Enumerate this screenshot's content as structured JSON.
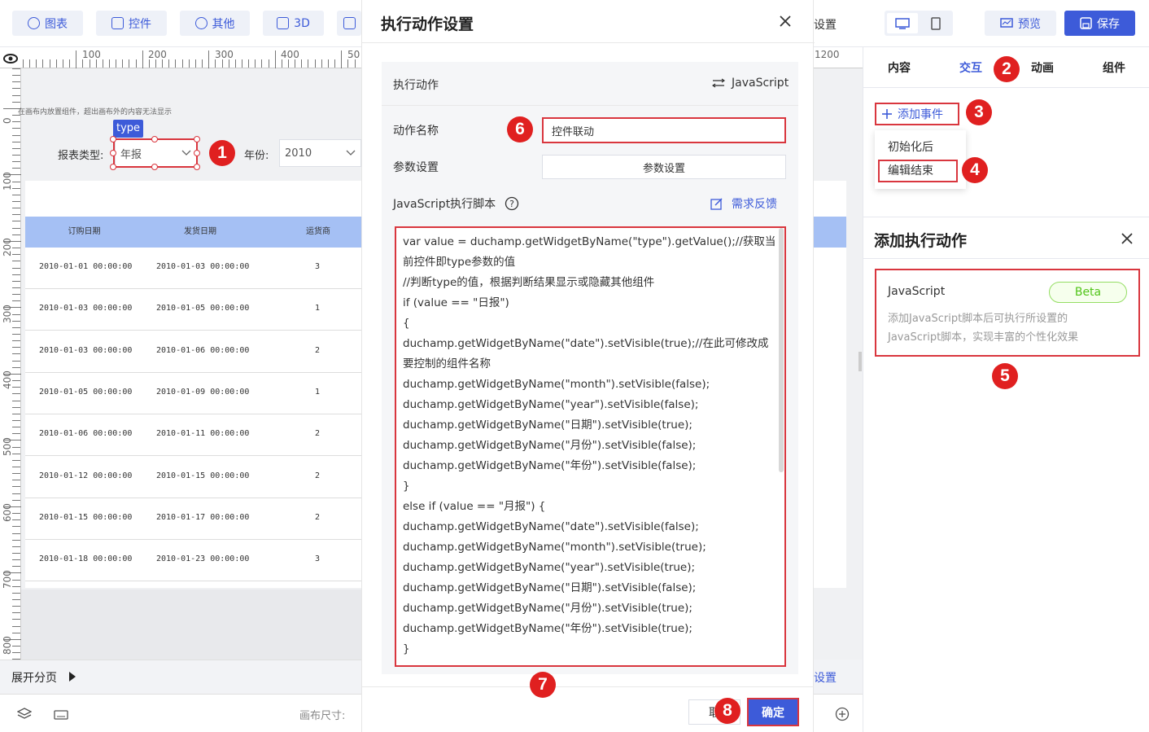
{
  "toolbar": {
    "chart_label": "图表",
    "widget_label": "控件",
    "other_label": "其他",
    "threed_label": "3D",
    "settings_partial": "设置",
    "preview_label": "预览",
    "save_label": "保存"
  },
  "canvas": {
    "hint": "在画布内放置组件，超出画布外的内容无法显示",
    "type_tag": "type",
    "report_type_label": "报表类型:",
    "report_type_value": "年报",
    "year_label": "年份:",
    "year_value": "2010",
    "ruler_top": [
      "100",
      "200",
      "300",
      "400",
      "50"
    ],
    "ruler_left": [
      "0",
      "100",
      "200",
      "300",
      "400",
      "500",
      "600",
      "700",
      "800"
    ],
    "table": {
      "headers": [
        "订购日期",
        "发货日期",
        "运货商"
      ],
      "rows": [
        [
          "2010-01-01 00:00:00",
          "2010-01-03 00:00:00",
          "3"
        ],
        [
          "2010-01-03 00:00:00",
          "2010-01-05 00:00:00",
          "1"
        ],
        [
          "2010-01-03 00:00:00",
          "2010-01-06 00:00:00",
          "2"
        ],
        [
          "2010-01-05 00:00:00",
          "2010-01-09 00:00:00",
          "1"
        ],
        [
          "2010-01-06 00:00:00",
          "2010-01-11 00:00:00",
          "2"
        ],
        [
          "2010-01-12 00:00:00",
          "2010-01-15 00:00:00",
          "2"
        ],
        [
          "2010-01-15 00:00:00",
          "2010-01-17 00:00:00",
          "2"
        ],
        [
          "2010-01-18 00:00:00",
          "2010-01-23 00:00:00",
          "3"
        ]
      ]
    },
    "expand_paging": "展开分页",
    "canvas_size_label": "画布尺寸:"
  },
  "dialog": {
    "title": "执行动作设置",
    "exec_action_label": "执行动作",
    "exec_action_value": "JavaScript",
    "action_name_label": "动作名称",
    "action_name_value": "控件联动",
    "param_label": "参数设置",
    "param_button": "参数设置",
    "script_label": "JavaScript执行脚本",
    "feedback_link": "需求反馈",
    "script_lines": [
      "var value = duchamp.getWidgetByName(\"type\").getValue();//获取当",
      "前控件即type参数的值",
      "//判断type的值，根据判断结果显示或隐藏其他组件",
      "if (value == \"日报\")",
      "{",
      "duchamp.getWidgetByName(\"date\").setVisible(true);//在此可修改成",
      "要控制的组件名称",
      "duchamp.getWidgetByName(\"month\").setVisible(false);",
      "duchamp.getWidgetByName(\"year\").setVisible(false);",
      "duchamp.getWidgetByName(\"日期\").setVisible(true);",
      "duchamp.getWidgetByName(\"月份\").setVisible(false);",
      "duchamp.getWidgetByName(\"年份\").setVisible(false);",
      "}",
      "else if (value == \"月报\") {",
      "duchamp.getWidgetByName(\"date\").setVisible(false);",
      "duchamp.getWidgetByName(\"month\").setVisible(true);",
      "duchamp.getWidgetByName(\"year\").setVisible(true);",
      "duchamp.getWidgetByName(\"日期\").setVisible(false);",
      "duchamp.getWidgetByName(\"月份\").setVisible(true);",
      "duchamp.getWidgetByName(\"年份\").setVisible(true);",
      "}"
    ],
    "cancel_label": "取",
    "confirm_label": "确定"
  },
  "right_panel": {
    "tabs": [
      "内容",
      "交互",
      "动画",
      "组件"
    ],
    "add_event": "添加事件",
    "event_options": [
      "初始化后",
      "编辑结束"
    ],
    "add_action_title": "添加执行动作",
    "js_card_title": "JavaScript",
    "js_card_badge": "Beta",
    "js_card_desc_1": "添加JavaScript脚本后可执行所设置的",
    "js_card_desc_2": "JavaScript脚本，实现丰富的个性化效果",
    "ruler_partial": "1200",
    "settings_partial": "设置"
  },
  "badges": [
    "1",
    "2",
    "3",
    "4",
    "5",
    "6",
    "7",
    "8"
  ],
  "colors": {
    "accent": "#3d5bd9",
    "annotation_red": "#e02020",
    "header_blue": "#a5c0f4",
    "beta_green": "#52c41a"
  }
}
